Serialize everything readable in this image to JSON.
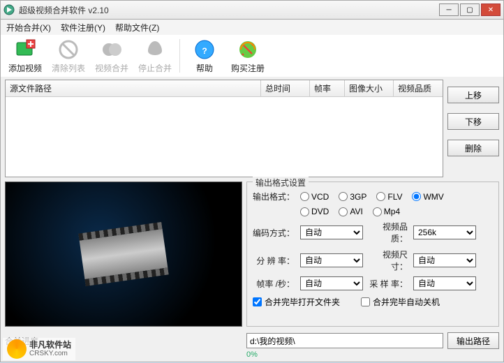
{
  "window": {
    "title": "超级视频合并软件 v2.10"
  },
  "menu": {
    "start": "开始合并(X)",
    "register": "软件注册(Y)",
    "help": "帮助文件(Z)"
  },
  "toolbar": {
    "add": "添加视频",
    "clear": "清除列表",
    "merge": "视频合并",
    "stop": "停止合并",
    "help": "帮助",
    "buy": "购买注册"
  },
  "columns": {
    "path": "源文件路径",
    "duration": "总时间",
    "fps": "帧率",
    "size": "图像大小",
    "quality": "视频品质"
  },
  "side": {
    "up": "上移",
    "down": "下移",
    "delete": "删除"
  },
  "settings": {
    "legend": "输出格式设置",
    "format_label": "输出格式：",
    "formats": {
      "vcd": "VCD",
      "gp3": "3GP",
      "flv": "FLV",
      "wmv": "WMV",
      "dvd": "DVD",
      "avi": "AVI",
      "mp4": "Mp4"
    },
    "selected_format": "WMV",
    "encoding_label": "编码方式：",
    "encoding_value": "自动",
    "quality_label": "视频品质：",
    "quality_value": "256k",
    "resolution_label": "分 辨 率：",
    "resolution_value": "自动",
    "videosize_label": "视频尺寸：",
    "videosize_value": "自动",
    "fps_label": "帧率 /秒：",
    "fps_value": "自动",
    "sample_label": "采 样 率：",
    "sample_value": "自动",
    "cb_open": "合并完毕打开文件夹",
    "cb_open_checked": true,
    "cb_shutdown": "合并完毕自动关机",
    "cb_shutdown_checked": false
  },
  "bottom": {
    "progress_label": "合并进度",
    "path_value": "d:\\我的视频\\",
    "path_btn": "输出路径",
    "percent": "0%"
  },
  "watermark": {
    "zh": "非凡软件站",
    "en": "CRSKY.com"
  }
}
